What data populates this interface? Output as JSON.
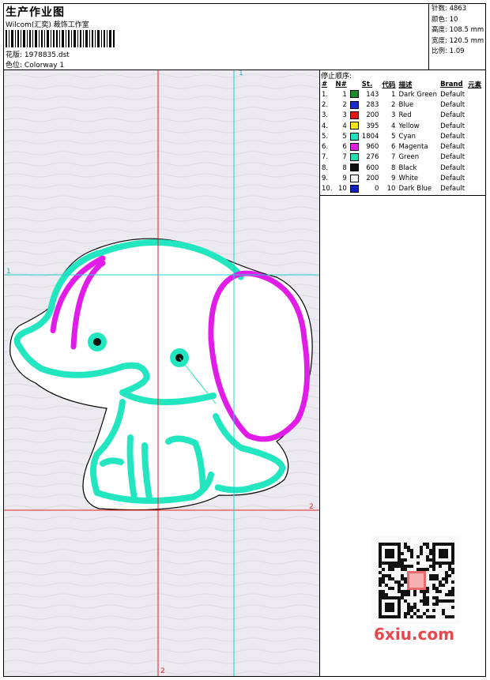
{
  "header": {
    "title": "生产作业图",
    "company": "Wilcom(汇奕) 裁饰工作室",
    "design_label": "花版:",
    "design_value": "1978835.dst",
    "colorway_label": "色位:",
    "colorway_value": "Colorway 1"
  },
  "stats": [
    {
      "label": "针数:",
      "value": "4863"
    },
    {
      "label": "颜色:",
      "value": "10"
    },
    {
      "label": "高度:",
      "value": "108.5 mm"
    },
    {
      "label": "宽度:",
      "value": "120.5 mm"
    },
    {
      "label": "比例:",
      "value": "1.09"
    }
  ],
  "guides": {
    "v1": "1",
    "h1": "1",
    "h2": "2",
    "v2": "2"
  },
  "stop_sequence": {
    "title": "停止顺序:",
    "columns": [
      "#",
      "N#",
      "St.",
      "代码",
      "描述",
      "Brand",
      "元素"
    ],
    "rows": [
      {
        "n": "1.",
        "nn": "1",
        "color": "#1a8a2a",
        "st": "143",
        "code": "1",
        "desc": "Dark Green",
        "brand": "Default"
      },
      {
        "n": "2.",
        "nn": "2",
        "color": "#1c2cc8",
        "st": "283",
        "code": "2",
        "desc": "Blue",
        "brand": "Default"
      },
      {
        "n": "3.",
        "nn": "3",
        "color": "#e01818",
        "st": "200",
        "code": "3",
        "desc": "Red",
        "brand": "Default"
      },
      {
        "n": "4.",
        "nn": "4",
        "color": "#f5e617",
        "st": "395",
        "code": "4",
        "desc": "Yellow",
        "brand": "Default"
      },
      {
        "n": "5.",
        "nn": "5",
        "color": "#20e0c0",
        "st": "1804",
        "code": "5",
        "desc": "Cyan",
        "brand": "Default"
      },
      {
        "n": "6.",
        "nn": "6",
        "color": "#e020e0",
        "st": "960",
        "code": "6",
        "desc": "Magenta",
        "brand": "Default"
      },
      {
        "n": "7.",
        "nn": "7",
        "color": "#20e0b0",
        "st": "276",
        "code": "7",
        "desc": "Green",
        "brand": "Default"
      },
      {
        "n": "8.",
        "nn": "8",
        "color": "#101010",
        "st": "600",
        "code": "8",
        "desc": "Black",
        "brand": "Default"
      },
      {
        "n": "9.",
        "nn": "9",
        "color": "#f4f4f4",
        "st": "200",
        "code": "9",
        "desc": "White",
        "brand": "Default"
      },
      {
        "n": "10.",
        "nn": "10",
        "color": "#1020c0",
        "st": "0",
        "code": "10",
        "desc": "Dark Blue",
        "brand": "Default"
      }
    ]
  },
  "watermark": {
    "logo": "6xiu.com"
  },
  "colors": {
    "guide_red": "#e02020",
    "guide_cyan": "#20d0d0",
    "stitch_cyan": "#22e6c0",
    "stitch_magenta": "#e21ce8",
    "canvas_bg": "#eceaf0"
  }
}
